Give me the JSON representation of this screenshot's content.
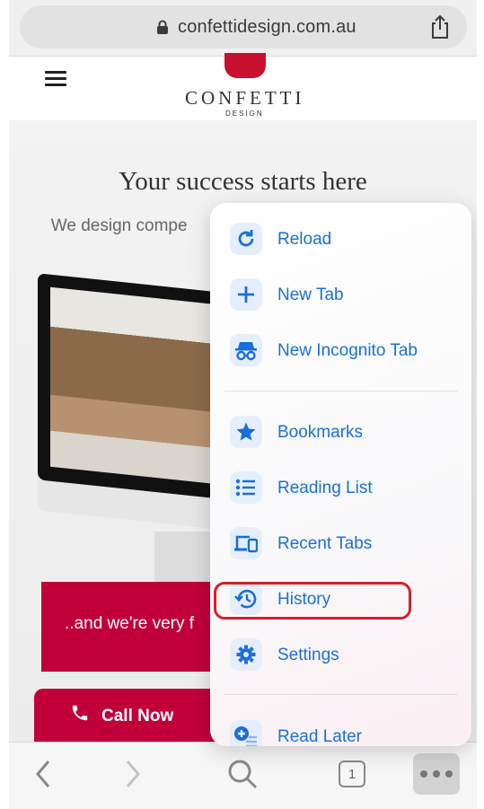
{
  "browser": {
    "url": "confettidesign.com.au",
    "tab_count": "1"
  },
  "site": {
    "logo_name": "CONFETTI",
    "logo_sub": "DESIGN",
    "hero_title": "Your success starts here",
    "hero_text": "We design compe                       convert and clever                     your b",
    "banner_text": "..and we're very f",
    "call_label": "Call Now",
    "brand_color": "#c1003a"
  },
  "menu": {
    "accent": "#1a6fd8",
    "items": [
      {
        "label": "Reload",
        "icon": "reload-icon"
      },
      {
        "label": "New Tab",
        "icon": "plus-icon"
      },
      {
        "label": "New Incognito Tab",
        "icon": "incognito-icon"
      },
      {
        "label": "Bookmarks",
        "icon": "star-icon"
      },
      {
        "label": "Reading List",
        "icon": "list-icon"
      },
      {
        "label": "Recent Tabs",
        "icon": "devices-icon"
      },
      {
        "label": "History",
        "icon": "history-icon"
      },
      {
        "label": "Settings",
        "icon": "gear-icon"
      },
      {
        "label": "Read Later",
        "icon": "read-later-icon"
      }
    ],
    "highlighted": "History",
    "highlight_color": "#d81e2a"
  }
}
